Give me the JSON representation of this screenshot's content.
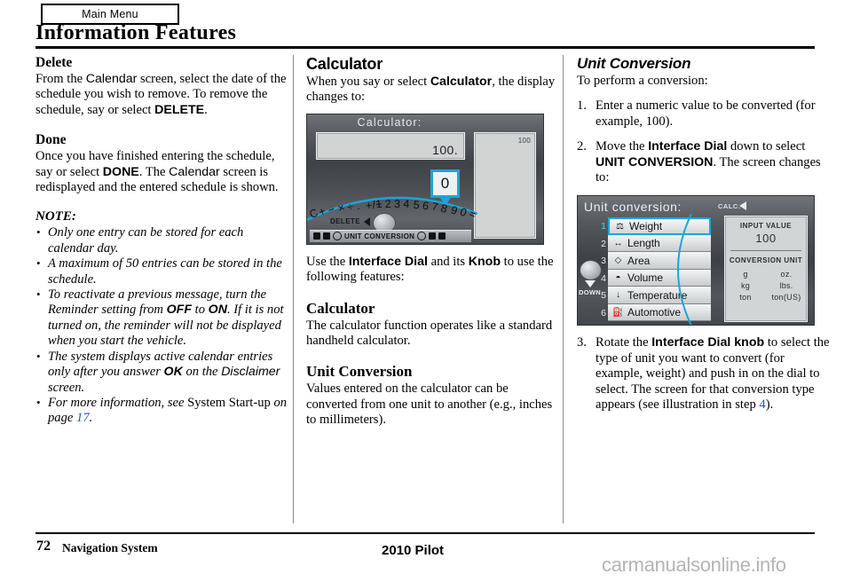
{
  "header": {
    "tab_label": "Main Menu",
    "page_title": "Information Features"
  },
  "left_column": {
    "delete": {
      "heading": "Delete",
      "p1_a": "From the ",
      "p1_calendar": "Calendar",
      "p1_b": " screen, select the date of the schedule you wish to remove. To remove the schedule, say or select ",
      "p1_delete": "DELETE",
      "p1_c": "."
    },
    "done": {
      "heading": "Done",
      "p1_a": "Once you have finished entering the schedule, say or select ",
      "p1_done": "DONE",
      "p1_b": ". The ",
      "p1_calendar": "Calendar",
      "p1_c": " screen is redisplayed and the entered schedule is shown."
    },
    "note_heading": "NOTE:",
    "notes": [
      {
        "parts": [
          {
            "t": "Only one entry can be stored for each calendar day.",
            "s": "it"
          }
        ]
      },
      {
        "parts": [
          {
            "t": "A maximum of 50 entries can be stored in the schedule.",
            "s": "it"
          }
        ]
      },
      {
        "parts": [
          {
            "t": "To reactivate a previous message, turn the Reminder setting from ",
            "s": "it"
          },
          {
            "t": "OFF",
            "s": "sans-b"
          },
          {
            "t": " to ",
            "s": "it"
          },
          {
            "t": "ON",
            "s": "sans-b"
          },
          {
            "t": ". If it is not turned on, the reminder will not be displayed when you start the vehicle.",
            "s": "it"
          }
        ]
      },
      {
        "parts": [
          {
            "t": "The system displays active calendar entries only after you answer ",
            "s": "it"
          },
          {
            "t": "OK",
            "s": "sans-b"
          },
          {
            "t": " on the ",
            "s": "it"
          },
          {
            "t": "Disclaimer",
            "s": "sans-n"
          },
          {
            "t": " screen.",
            "s": "it"
          }
        ]
      },
      {
        "parts": [
          {
            "t": "For more information, see ",
            "s": "it"
          },
          {
            "t": "System Start-up",
            "s": "rm"
          },
          {
            "t": " on page ",
            "s": "it"
          },
          {
            "t": "17",
            "s": "link-it"
          },
          {
            "t": ".",
            "s": "it"
          }
        ]
      }
    ]
  },
  "middle_column": {
    "calculator_heading": "Calculator",
    "intro_a": "When you say or select ",
    "intro_calc": "Calculator",
    "intro_b": ", the display changes to:",
    "calc_screenshot": {
      "title": "Calculator:",
      "display_value": "100.",
      "right_panel_value": "100",
      "tooltip_value": "0",
      "char_row": [
        "C",
        "+",
        "−",
        "×",
        "÷",
        ".",
        "+/−",
        "1",
        "2",
        "3",
        "4",
        "5",
        "6",
        "7",
        "8",
        "9",
        "0",
        "="
      ],
      "delete_label": "DELETE",
      "bottom_bar_label": "UNIT CONVERSION"
    },
    "use_dial_a": "Use the ",
    "use_dial_b": "Interface Dial",
    "use_dial_c": " and its ",
    "use_dial_d": "Knob",
    "use_dial_e": " to use the following features:",
    "calculator_sub_heading": "Calculator",
    "calculator_sub_text": "The calculator function operates like a standard handheld calculator.",
    "unit_conversion_heading": "Unit Conversion",
    "unit_conversion_text": "Values entered on the calculator can be converted from one unit to another (e.g., inches to millimeters)."
  },
  "right_column": {
    "heading": "Unit Conversion",
    "intro": "To perform a conversion:",
    "steps": [
      {
        "parts": [
          {
            "t": "Enter a numeric value to be converted (for example, 100).",
            "s": "rm"
          }
        ]
      },
      {
        "parts": [
          {
            "t": "Move the ",
            "s": "rm"
          },
          {
            "t": "Interface Dial",
            "s": "sans-b"
          },
          {
            "t": " down to select ",
            "s": "rm"
          },
          {
            "t": "UNIT CONVERSION",
            "s": "sans-b"
          },
          {
            "t": ". The screen changes to:",
            "s": "rm"
          }
        ]
      },
      {
        "parts": [
          {
            "t": "Rotate the ",
            "s": "rm"
          },
          {
            "t": "Interface Dial knob",
            "s": "sans-b"
          },
          {
            "t": " to select the type of unit you want to convert (for example, weight) and push in on the dial to select. The screen for that conversion type appears (see illustration in step ",
            "s": "rm"
          },
          {
            "t": "4",
            "s": "link"
          },
          {
            "t": ").",
            "s": "rm"
          }
        ]
      }
    ],
    "uc_screenshot": {
      "title": "Unit conversion:",
      "calc_label": "CALC.",
      "down_label": "DOWN",
      "items": [
        {
          "num": "1",
          "icon": "weight-icon",
          "glyph": "⚖",
          "label": "Weight",
          "selected": true
        },
        {
          "num": "2",
          "icon": "length-icon",
          "glyph": "↔",
          "label": "Length",
          "selected": false
        },
        {
          "num": "3",
          "icon": "area-icon",
          "glyph": "◇",
          "label": "Area",
          "selected": false
        },
        {
          "num": "4",
          "icon": "volume-icon",
          "glyph": "◓",
          "label": "Volume",
          "selected": false
        },
        {
          "num": "5",
          "icon": "temperature-icon",
          "glyph": "↓",
          "label": "Temperature",
          "selected": false
        },
        {
          "num": "6",
          "icon": "automotive-icon",
          "glyph": "⛽",
          "label": "Automotive",
          "selected": false
        }
      ],
      "input_value_label": "INPUT VALUE",
      "input_value": "100",
      "conversion_unit_label": "CONVERSION UNIT",
      "units": [
        "g",
        "oz.",
        "kg",
        "lbs.",
        "ton",
        "ton(US)"
      ]
    }
  },
  "footer": {
    "page_number": "72",
    "section_label": "Navigation System",
    "model": "2010 Pilot",
    "watermark": "carmanualsonline.info"
  },
  "colors": {
    "link": "#2a4fc4",
    "highlight": "#19a7d8",
    "rule": "#000000",
    "watermark": "#b4b4b4"
  }
}
